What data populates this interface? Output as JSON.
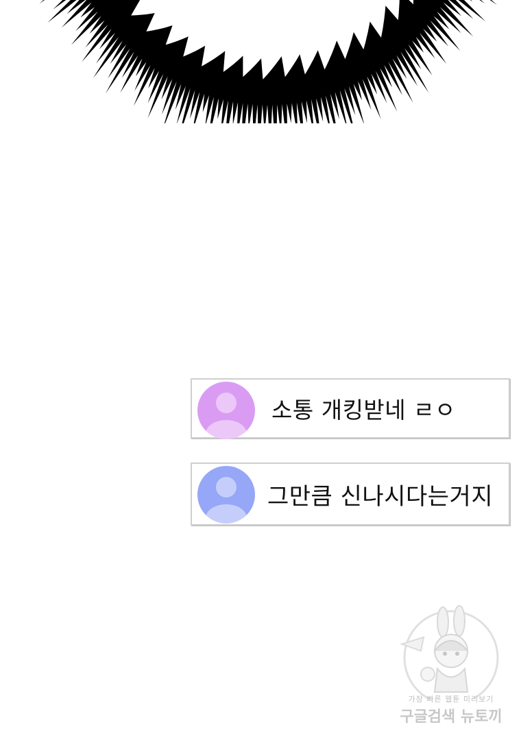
{
  "comments": [
    {
      "avatar_color": "#da9cf3",
      "text": "소통 개킹받네 ㄹㅇ"
    },
    {
      "avatar_color": "#96a7f7",
      "text": "그만큼 신나시다는거지"
    }
  ],
  "watermark": {
    "line1": "가장 빠른 웹툰 미리보기",
    "line2": "구글검색 뉴토끼"
  }
}
